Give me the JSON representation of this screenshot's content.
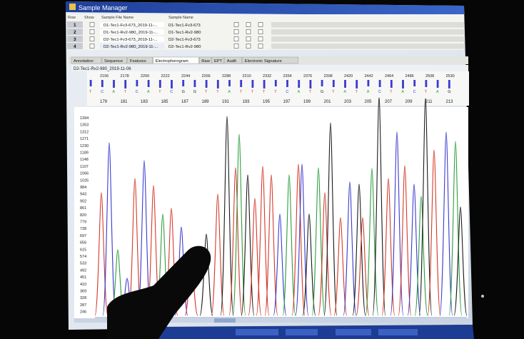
{
  "window": {
    "title": "Sample Manager"
  },
  "table": {
    "headers": {
      "row": "Row",
      "show": "Show",
      "sample_file": "Sample File Name",
      "sample_name": "Sample Name"
    },
    "rows": [
      {
        "index": "1",
        "file": "D1-Tec1-Fv3-673_2019-11-...",
        "name": "D1-Tec1-Fv3-673"
      },
      {
        "index": "2",
        "file": "D1-Tec1-Rv2-980_2019-11-...",
        "name": "D1-Tec1-Rv2-980"
      },
      {
        "index": "3",
        "file": "D2-Tec1-Fv3-673_2019-11-...",
        "name": "D2-Tec1-Fv3-673"
      },
      {
        "index": "4",
        "file": "D2-Tec1-Rv2-980_2019-11-...",
        "name": "D2-Tec1-Rv2-980"
      }
    ]
  },
  "tabs": [
    "Annotation",
    "Sequence",
    "Features",
    "Electropherogram",
    "Raw",
    "EPT",
    "Audit",
    "Electronic Signature"
  ],
  "active_tab": "Electropherogram",
  "trace": {
    "sample_label": "D2-Tec1-Rv2-980_2019-11-06",
    "top_scale": [
      "2156",
      "2178",
      "2200",
      "2222",
      "2244",
      "2266",
      "2288",
      "2310",
      "2332",
      "2354",
      "2376",
      "2398",
      "2420",
      "2442",
      "2464",
      "2486",
      "2508",
      "2530"
    ],
    "bases": [
      "T",
      "C",
      "A",
      "T",
      "C",
      "A",
      "T",
      "C",
      "G",
      "G",
      "T",
      "T",
      "A",
      "T",
      "T",
      "T",
      "T",
      "C",
      "A",
      "T",
      "G",
      "T",
      "A",
      "T",
      "A",
      "C",
      "T",
      "A",
      "C",
      "T",
      "A",
      "G"
    ],
    "bottom_scale": [
      "179",
      "181",
      "183",
      "185",
      "187",
      "189",
      "191",
      "193",
      "195",
      "197",
      "199",
      "201",
      "203",
      "205",
      "207",
      "209",
      "211",
      "213"
    ],
    "y_axis": [
      "1394",
      "1353",
      "1312",
      "1271",
      "1230",
      "1189",
      "1148",
      "1107",
      "1066",
      "1025",
      "984",
      "943",
      "902",
      "861",
      "820",
      "779",
      "738",
      "697",
      "656",
      "615",
      "574",
      "533",
      "492",
      "451",
      "410",
      "369",
      "328",
      "287",
      "246"
    ],
    "colors": {
      "A": "#2e9e3e",
      "C": "#3a3ad0",
      "G": "#1a1a1a",
      "T": "#d43a2a"
    }
  }
}
